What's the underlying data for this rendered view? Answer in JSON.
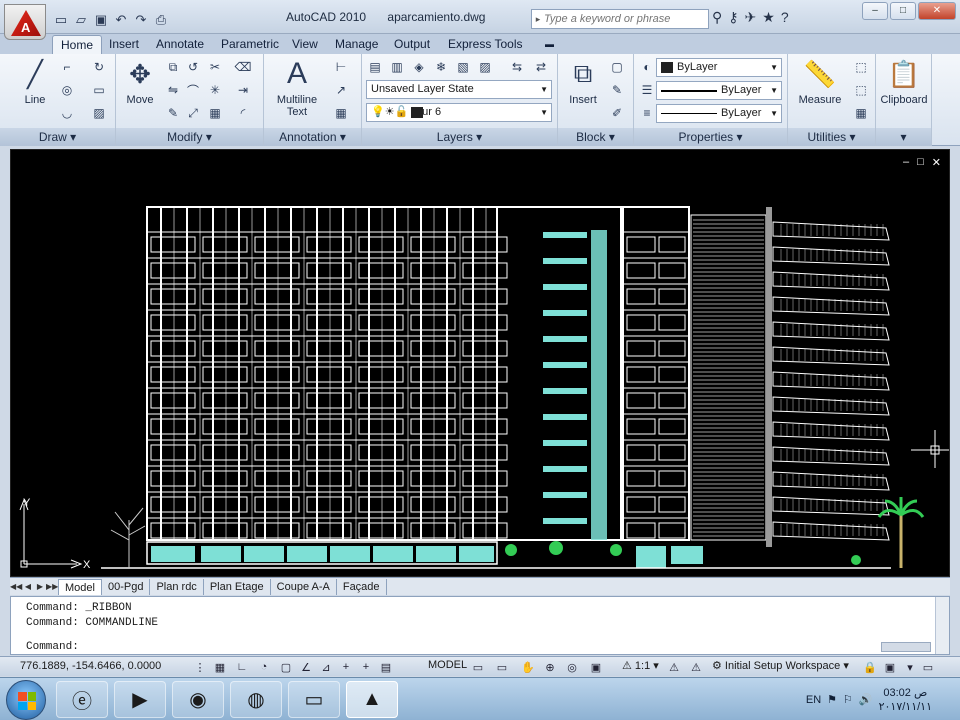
{
  "titlebar": {
    "app_name": "AutoCAD 2010",
    "file_name": "aparcamiento.dwg",
    "search_placeholder": "Type a keyword or phrase",
    "tool_icons": [
      "binoculars-icon",
      "key-icon",
      "satellite-icon",
      "star-icon",
      "help-icon"
    ],
    "window_buttons": [
      "–",
      "□",
      "✕"
    ]
  },
  "quick_access": [
    "new-icon",
    "open-icon",
    "save-icon",
    "undo-icon",
    "redo-icon",
    "plot-icon"
  ],
  "ribbon_tabs": [
    "Home",
    "Insert",
    "Annotate",
    "Parametric",
    "View",
    "Manage",
    "Output",
    "Express Tools"
  ],
  "active_tab": "Home",
  "ribbon": {
    "draw": {
      "title": "Draw",
      "line_label": "Line"
    },
    "modify": {
      "title": "Modify",
      "move_label": "Move"
    },
    "annotation": {
      "title": "Annotation",
      "text_label_1": "Multiline",
      "text_label_2": "Text"
    },
    "layers": {
      "title": "Layers",
      "layer_state": "Unsaved Layer State",
      "current_layer": "mur 6"
    },
    "block": {
      "title": "Block",
      "insert_label": "Insert"
    },
    "properties": {
      "title": "Properties",
      "color": "ByLayer",
      "linetype": "ByLayer",
      "lineweight": "ByLayer"
    },
    "utilities": {
      "title": "Utilities",
      "measure_label": "Measure"
    },
    "clipboard": {
      "title": "Clipboard"
    }
  },
  "viewport_controls": [
    "–",
    "□",
    "✕"
  ],
  "ucs": {
    "x_label": "X",
    "y_label": "Y"
  },
  "layout_tabs": [
    "Model",
    "00-Pgd",
    "Plan rdc",
    "Plan Etage",
    "Coupe A-A",
    "Façade"
  ],
  "active_layout": "Model",
  "command": {
    "history": [
      "Command: _RIBBON",
      "Command: COMMANDLINE"
    ],
    "prompt": "Command:"
  },
  "status": {
    "coordinates": "776.1889, -154.6466, 0.0000",
    "model_label": "MODEL",
    "scale": "1:1",
    "workspace": "Initial Setup Workspace"
  },
  "taskbar": {
    "apps": [
      "internet-explorer-icon",
      "media-player-icon",
      "chrome-icon",
      "firefox-icon",
      "folder-icon",
      "autocad-icon"
    ],
    "language": "EN",
    "time": "03:02 ص",
    "date": "٢٠١٧/١١/١١"
  },
  "colors": {
    "canvas": "#000000",
    "glass": "#7ee0d6",
    "ribbon": "#dfe8f3",
    "accent": "#c2432b"
  }
}
